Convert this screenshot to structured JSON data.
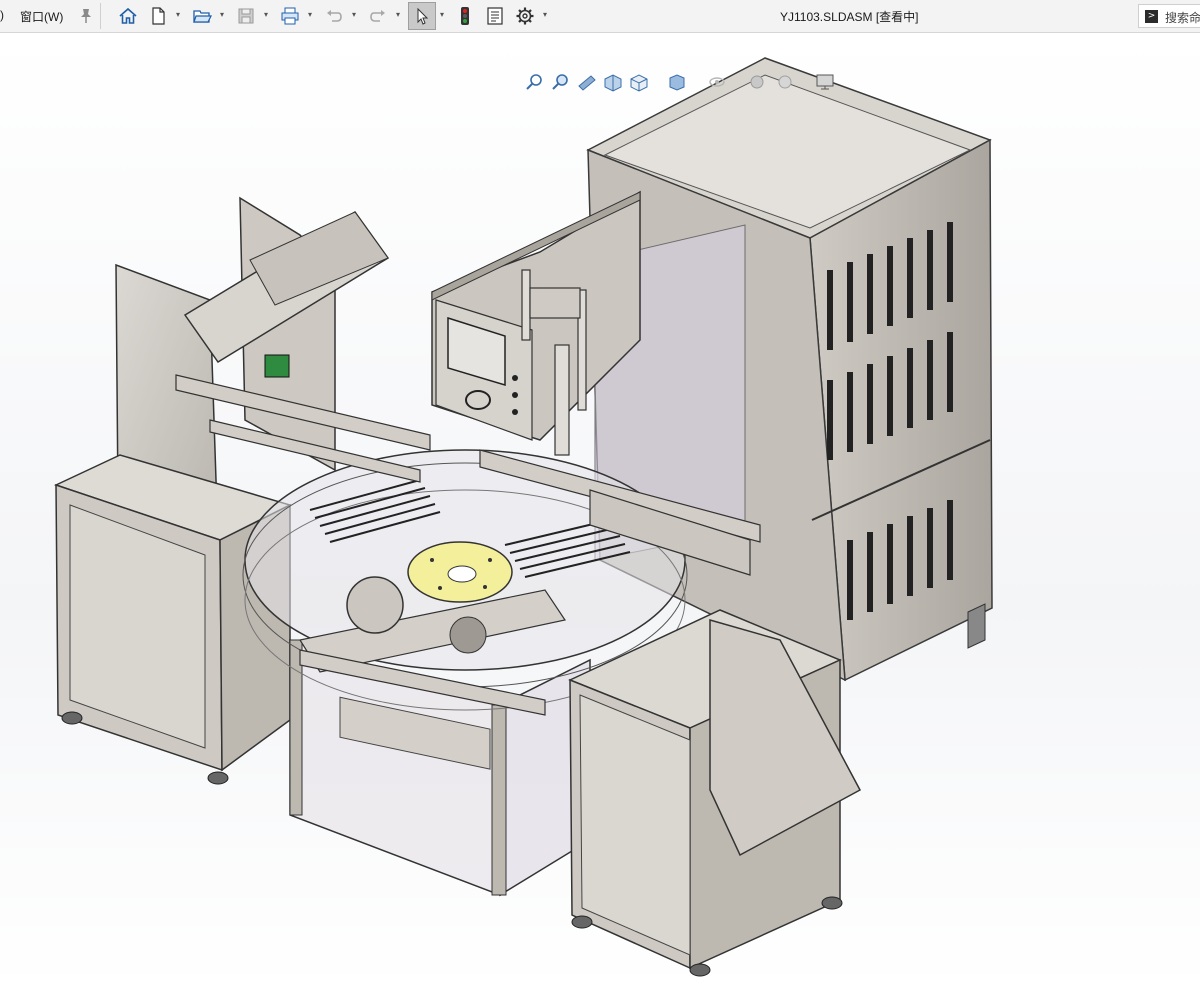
{
  "menubar": {
    "partial_left": ")",
    "window_menu": "窗口(W)"
  },
  "document": {
    "title": "YJ1103.SLDASM [查看中]"
  },
  "search": {
    "placeholder": "搜索命"
  },
  "toolbar": {
    "icons": [
      "pin-icon",
      "home-icon",
      "new-document-icon",
      "open-folder-icon",
      "save-icon",
      "print-icon",
      "undo-icon",
      "redo-icon",
      "select-pointer-icon",
      "traffic-light-icon",
      "file-properties-icon",
      "options-gear-icon"
    ]
  },
  "heads_up_toolbar": {
    "icons": [
      "zoom-to-fit-icon",
      "zoom-to-area-icon",
      "previous-view-icon",
      "section-view-icon",
      "view-orientation-icon",
      "display-style-icon",
      "hide-show-items-icon",
      "edit-appearance-icon",
      "apply-scene-icon",
      "view-settings-icon"
    ]
  },
  "model": {
    "name": "YJ1103 rotary assembly machine"
  }
}
